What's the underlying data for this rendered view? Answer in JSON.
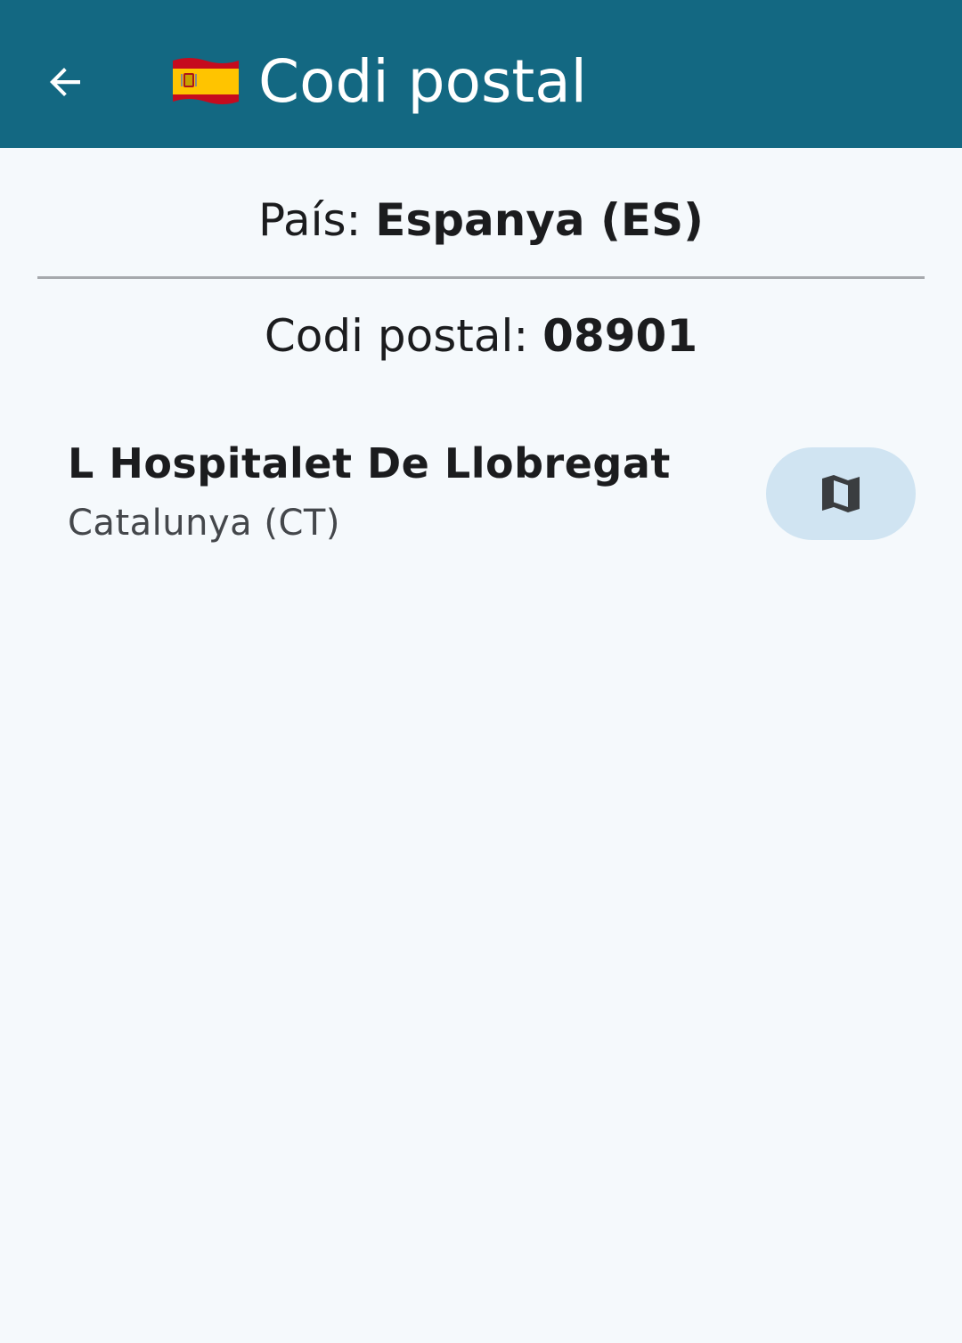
{
  "app_bar": {
    "title": "Codi postal",
    "back_icon": "arrow-back-icon",
    "flag_icon": "spain-flag-icon",
    "background_color": "#136882"
  },
  "details": {
    "country_label": "País:",
    "country_value": "Espanya (ES)",
    "postal_label": "Codi postal:",
    "postal_value": "08901"
  },
  "results": [
    {
      "city": "L Hospitalet De Llobregat",
      "region": "Catalunya (CT)",
      "action_icon": "map-icon"
    }
  ],
  "colors": {
    "background": "#f5f9fc",
    "map_button_bg": "#d0e4f2"
  }
}
